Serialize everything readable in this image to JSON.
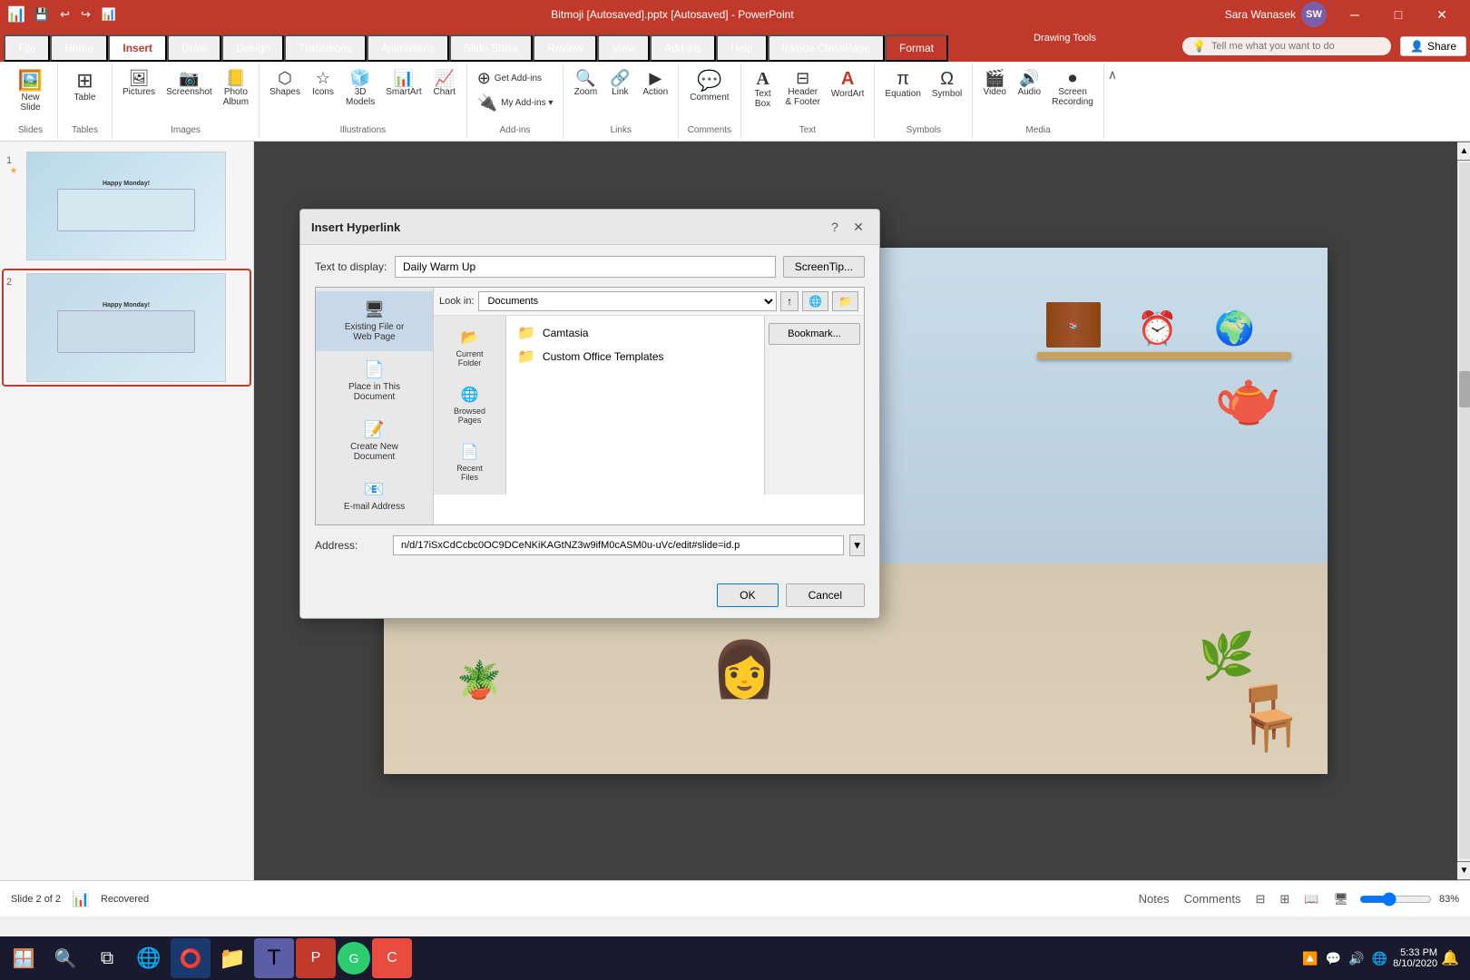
{
  "titlebar": {
    "title": "Bitmoji [Autosaved].pptx [Autosaved] - PowerPoint",
    "qat": [
      "💾",
      "↩",
      "↪",
      "📊"
    ],
    "drawing_tools": "Drawing Tools",
    "win_controls": [
      "─",
      "□",
      "✕"
    ]
  },
  "user": {
    "name": "Sara Wanasek",
    "initials": "SW",
    "avatar_color": "#7b5ea7"
  },
  "ribbon": {
    "tabs": [
      "File",
      "Home",
      "Insert",
      "Draw",
      "Design",
      "Transitions",
      "Animations",
      "Slide Show",
      "Review",
      "View",
      "Add-ins",
      "Help",
      "Inknoe ClassPage",
      "Format"
    ],
    "active_tab": "Insert",
    "groups": [
      {
        "name": "Slides",
        "items": [
          {
            "label": "New\nSlide",
            "icon": "🖼️"
          }
        ]
      },
      {
        "name": "Tables",
        "items": [
          {
            "label": "Table",
            "icon": "⊞"
          }
        ]
      },
      {
        "name": "Images",
        "items": [
          {
            "label": "Pictures",
            "icon": "🖼"
          },
          {
            "label": "Screenshot",
            "icon": "📷"
          },
          {
            "label": "Photo\nAlbum",
            "icon": "📒"
          }
        ]
      },
      {
        "name": "Illustrations",
        "items": [
          {
            "label": "Shapes",
            "icon": "⬡"
          },
          {
            "label": "Icons",
            "icon": "☆"
          },
          {
            "label": "3D\nModels",
            "icon": "🧊"
          },
          {
            "label": "SmartArt",
            "icon": "📊"
          },
          {
            "label": "Chart",
            "icon": "📈"
          }
        ]
      },
      {
        "name": "Add-ins",
        "items": [
          {
            "label": "Get Add-ins",
            "icon": "⊕"
          },
          {
            "label": "My Add-ins",
            "icon": "🔌"
          }
        ]
      },
      {
        "name": "Links",
        "items": [
          {
            "label": "Zoom",
            "icon": "🔍"
          },
          {
            "label": "Link",
            "icon": "🔗"
          },
          {
            "label": "Action",
            "icon": "▶"
          }
        ]
      },
      {
        "name": "Comments",
        "items": [
          {
            "label": "Comment",
            "icon": "💬"
          }
        ]
      },
      {
        "name": "Text",
        "items": [
          {
            "label": "Text\nBox",
            "icon": "A"
          },
          {
            "label": "Header\n& Footer",
            "icon": "⊟"
          },
          {
            "label": "WordArt",
            "icon": "A"
          }
        ]
      },
      {
        "name": "Symbols",
        "items": [
          {
            "label": "Equation",
            "icon": "π"
          },
          {
            "label": "Symbol",
            "icon": "Ω"
          }
        ]
      },
      {
        "name": "Media",
        "items": [
          {
            "label": "Video",
            "icon": "🎬"
          },
          {
            "label": "Audio",
            "icon": "🔊"
          },
          {
            "label": "Screen\nRecording",
            "icon": "⏺"
          }
        ]
      }
    ]
  },
  "search": {
    "placeholder": "Tell me what you want to do",
    "icon": "💡"
  },
  "share_btn": "Share",
  "slides": [
    {
      "num": "1",
      "star": true,
      "active": false,
      "bg": "#e8f4f8"
    },
    {
      "num": "2",
      "star": false,
      "active": true,
      "bg": "#d8ecf4"
    }
  ],
  "dialog": {
    "title": "Insert Hyperlink",
    "text_to_display_label": "Text to display:",
    "text_to_display_value": "Daily Warm Up",
    "screentip_btn": "ScreenTip...",
    "lookin_label": "Look in:",
    "lookin_value": "Documents",
    "link_types": [
      {
        "label": "Existing File or\nWeb Page",
        "icon": "🖥"
      },
      {
        "label": "Place in This\nDocument",
        "icon": "📄"
      },
      {
        "label": "Create New\nDocument",
        "icon": "📝"
      },
      {
        "label": "E-mail Address",
        "icon": "📧"
      }
    ],
    "active_link_type": 0,
    "files": [
      {
        "name": "Camtasia",
        "icon": "📁"
      },
      {
        "name": "Custom Office Templates",
        "icon": "📁"
      }
    ],
    "browsed_labels": [
      "Browsed\nPages",
      "Recent\nFiles"
    ],
    "side_btns": [
      "Bookmark..."
    ],
    "address_label": "Address:",
    "address_value": "n/d/17iSxCdCcbc0OC9DCeNKiKAGtNZ3w9ifM0cASM0u-uVc/edit#slide=id.p",
    "ok_btn": "OK",
    "cancel_btn": "Cancel",
    "help_btn": "?"
  },
  "status": {
    "slide_info": "Slide 2 of 2",
    "recovered": "Recovered",
    "notes_btn": "Notes",
    "comments_btn": "Comments",
    "zoom": "83%"
  },
  "taskbar": {
    "time": "5:33 PM",
    "date": "8/10/2020",
    "apps": [
      {
        "icon": "🪟",
        "name": "start"
      },
      {
        "icon": "🔍",
        "name": "search"
      },
      {
        "icon": "🗄",
        "name": "task-view"
      },
      {
        "icon": "🌐",
        "name": "edge"
      },
      {
        "icon": "🔎",
        "name": "cortana"
      },
      {
        "icon": "📁",
        "name": "explorer"
      },
      {
        "icon": "🔵",
        "name": "teams"
      },
      {
        "icon": "📊",
        "name": "powerpoint"
      },
      {
        "icon": "🟢",
        "name": "green-app"
      },
      {
        "icon": "🔴",
        "name": "red-app"
      }
    ],
    "systray": [
      "🔼",
      "💬",
      "🔊",
      "🌐"
    ]
  }
}
